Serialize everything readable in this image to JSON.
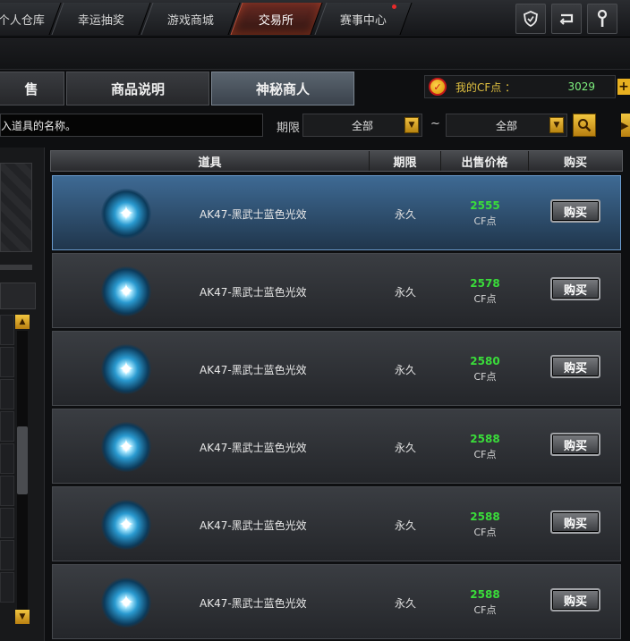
{
  "nav": {
    "tabs": [
      "个人仓库",
      "幸运抽奖",
      "游戏商城",
      "交易所",
      "赛事中心"
    ],
    "active": "交易所",
    "icons": [
      "shield-icon",
      "return-icon",
      "wrench-icon"
    ]
  },
  "subtabs": [
    "售",
    "商品说明",
    "神秘商人"
  ],
  "cf": {
    "label": "我的CF点 ：",
    "value": "3029",
    "plus": "+"
  },
  "search": {
    "placeholder": "入道具的名称。",
    "period_label": "期限",
    "select1": "全部",
    "tilde": "~",
    "select2": "全部"
  },
  "table": {
    "headers": [
      "道具",
      "期限",
      "出售价格",
      "购买"
    ],
    "rows": [
      {
        "name": "AK47-黑武士蓝色光效",
        "period": "永久",
        "price": "2555",
        "unit": "CF点",
        "buy": "购买",
        "selected": true
      },
      {
        "name": "AK47-黑武士蓝色光效",
        "period": "永久",
        "price": "2578",
        "unit": "CF点",
        "buy": "购买"
      },
      {
        "name": "AK47-黑武士蓝色光效",
        "period": "永久",
        "price": "2580",
        "unit": "CF点",
        "buy": "购买"
      },
      {
        "name": "AK47-黑武士蓝色光效",
        "period": "永久",
        "price": "2588",
        "unit": "CF点",
        "buy": "购买"
      },
      {
        "name": "AK47-黑武士蓝色光效",
        "period": "永久",
        "price": "2588",
        "unit": "CF点",
        "buy": "购买"
      },
      {
        "name": "AK47-黑武士蓝色光效",
        "period": "永久",
        "price": "2588",
        "unit": "CF点",
        "buy": "购买"
      }
    ]
  },
  "colors": {
    "price": "#3adc3a",
    "accent": "#e8b020",
    "selected_row": "#3e6a94"
  }
}
